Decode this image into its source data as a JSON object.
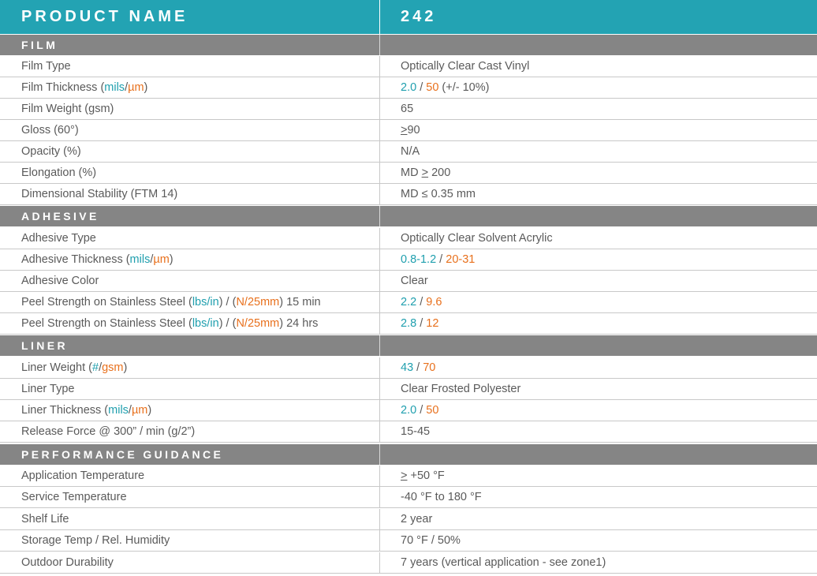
{
  "colors": {
    "header_bg": "#23a3b3",
    "section_bg": "#858585",
    "teal": "#1f9fae",
    "orange": "#e8701c",
    "text": "#5a5a5a"
  },
  "header": {
    "label": "PRODUCT NAME",
    "value": "242"
  },
  "film": {
    "title": "FILM",
    "rows": [
      {
        "label": "Film Type",
        "value": "Optically Clear Cast Vinyl"
      },
      {
        "label_pre": "Film Thickness (",
        "label_teal": "mils",
        "label_sep": "/",
        "label_orange": "µm",
        "label_post": ")",
        "v_teal": "2.0",
        "v_sep": " / ",
        "v_orange": "50",
        "v_post": " (+/- 10%)"
      },
      {
        "label": "Film Weight (gsm)",
        "value": "65"
      },
      {
        "label": "Gloss (60°)",
        "value_ul": ">",
        "value": "90"
      },
      {
        "label": "Opacity (%)",
        "value": "N/A"
      },
      {
        "label": "Elongation (%)",
        "value_pre": "MD ",
        "value_ul": ">",
        "value": " 200"
      },
      {
        "label": "Dimensional Stability (FTM 14)",
        "value": "MD ≤ 0.35 mm"
      }
    ]
  },
  "adhesive": {
    "title": "ADHESIVE",
    "rows": [
      {
        "label": "Adhesive Type",
        "value": "Optically Clear Solvent Acrylic"
      },
      {
        "label_pre": "Adhesive Thickness (",
        "label_teal": "mils",
        "label_sep": "/",
        "label_orange": "µm",
        "label_post": ")",
        "v_teal": "0.8-1.2",
        "v_sep": " / ",
        "v_orange": "20-31"
      },
      {
        "label": "Adhesive Color",
        "value": "Clear"
      },
      {
        "label_pre": "Peel Strength on Stainless Steel (",
        "label_teal": "lbs/in",
        "label_mid": ") / (",
        "label_orange": "N/25mm",
        "label_post": ") 15 min",
        "v_teal": "2.2",
        "v_sep": " / ",
        "v_orange": "9.6"
      },
      {
        "label_pre": "Peel Strength on Stainless Steel (",
        "label_teal": "lbs/in",
        "label_mid": ") / (",
        "label_orange": "N/25mm",
        "label_post": ") 24 hrs",
        "v_teal": "2.8",
        "v_sep": " / ",
        "v_orange": "12"
      }
    ]
  },
  "liner": {
    "title": "LINER",
    "rows": [
      {
        "label_pre": "Liner Weight (",
        "label_teal": "#",
        "label_sep": "/",
        "label_orange": "gsm",
        "label_post": ")",
        "v_teal": "43",
        "v_sep": " / ",
        "v_orange": "70"
      },
      {
        "label": "Liner Type",
        "value": "Clear Frosted Polyester"
      },
      {
        "label_pre": "Liner Thickness (",
        "label_teal": "mils",
        "label_sep": "/",
        "label_orange": "µm",
        "label_post": ")",
        "v_teal": "2.0",
        "v_sep": " / ",
        "v_orange": "50"
      },
      {
        "label": "Release Force @ 300” / min (g/2”)",
        "value": "15-45"
      }
    ]
  },
  "performance": {
    "title": "PERFORMANCE GUIDANCE",
    "rows": [
      {
        "label": "Application Temperature",
        "value_ul": ">",
        "value": " +50 °F"
      },
      {
        "label": "Service Temperature",
        "value": "-40 °F to 180 °F"
      },
      {
        "label": "Shelf Life",
        "value": "2 year"
      },
      {
        "label": "Storage Temp / Rel. Humidity",
        "value": "70 °F / 50%"
      },
      {
        "label": "Outdoor Durability",
        "value": "7 years (vertical application - see zone1)"
      }
    ]
  }
}
